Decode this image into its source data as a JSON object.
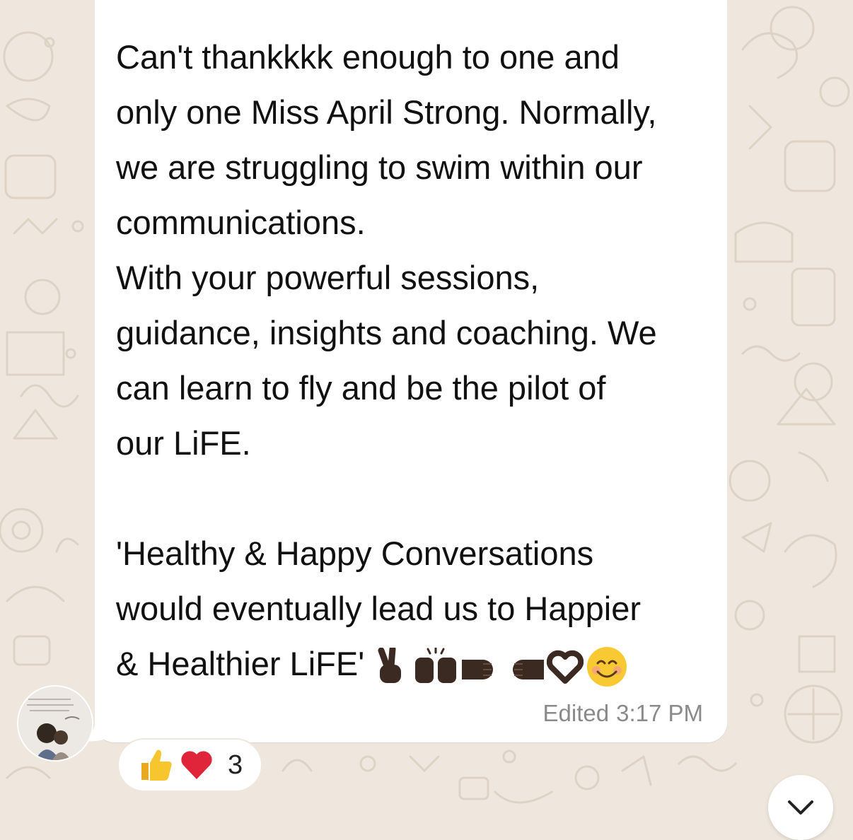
{
  "message": {
    "text": "Can't thankkkk enough to one and\nonly one Miss April Strong. Normally,\nwe are struggling to swim within our\ncommunications.\nWith your powerful sessions,\nguidance, insights and coaching. We\ncan learn to fly and be the pilot of\nour LiFE.\n\n'Healthy & Happy Conversations\nwould eventually lead us to Happier\n& Healthier LiFE'",
    "edited_label": "Edited",
    "time": "3:17 PM",
    "emojis": [
      "victory-hand-icon",
      "raising-hands-icon",
      "left-fist-icon",
      "right-fist-icon",
      "heart-hands-icon",
      "smiling-face-icon"
    ]
  },
  "reactions": {
    "icons": [
      "thumbs-up-icon",
      "red-heart-icon"
    ],
    "count": "3"
  },
  "colors": {
    "wallpaper": "#efe7dd",
    "bubble": "#ffffff",
    "meta_text": "#8a8a8a",
    "heart": "#e0243a",
    "thumb": "#f7c52d",
    "skin_dark": "#3b2a22"
  }
}
